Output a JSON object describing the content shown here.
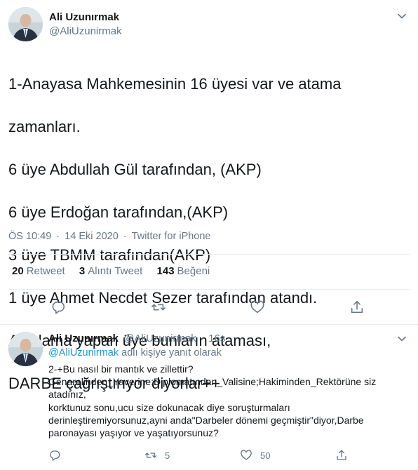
{
  "main_tweet": {
    "author_name": "Ali Uzunırmak",
    "author_handle": "@AliUzunirmak",
    "text_lines": [
      "1-Anayasa Mahkemesinin 16 üyesi var ve atama",
      "zamanları.",
      "6 üye Abdullah Gül tarafından, (AKP)",
      "6 üye Erdoğan tarafından,(AKP)",
      "3 üye TBMM tarafından(AKP)",
      "1 üye Ahmet Necdet Sezer tarafından atandı.",
      "Açıklama yapan üye bunların ataması,",
      "DARBE çağrıştırıyor diyorlar++"
    ],
    "time": "ÖS 10:49",
    "date": "14 Eki 2020",
    "source": "Twitter for iPhone",
    "separator": "·",
    "stats": {
      "retweets_count": "20",
      "retweets_label": "Retweet",
      "quotes_count": "3",
      "quotes_label": "Alıntı Tweet",
      "likes_count": "143",
      "likes_label": "Beğeni"
    }
  },
  "reply_tweet": {
    "author_name": "Ali Uzunırmak",
    "author_handle": "@AliUzunirmak",
    "separator": "·",
    "time_ago": "16s",
    "replying_mention": "@AliUzunirmak",
    "replying_suffix": "adlı kişiye yanıt olarak",
    "text_lines": [
      "2-+Bu nasıl bir mantık ve zillettir?",
      "Genarelinden_Yaverine;Diplomatından_Valisine;Hakiminden_Rektörüne siz",
      "atadınız,",
      "korktunuz sonu,ucu size dokunacak diye soruşturmaları",
      "derinleştiremiyorsunuz,ayni anda\"Darbeler dönemi geçmiştir\"diyor,Darbe",
      "paronayası yaşıyor ve yaşatıyorsunuz?"
    ],
    "retweets_count": "5",
    "likes_count": "50"
  },
  "colors": {
    "accent": "#1b95e0",
    "secondary_text": "#657786",
    "primary_text": "#14171a",
    "divider": "#e6ecf0"
  },
  "icons": [
    "avatar",
    "chevron-down-icon",
    "reply-icon",
    "retweet-icon",
    "like-icon",
    "share-icon"
  ]
}
